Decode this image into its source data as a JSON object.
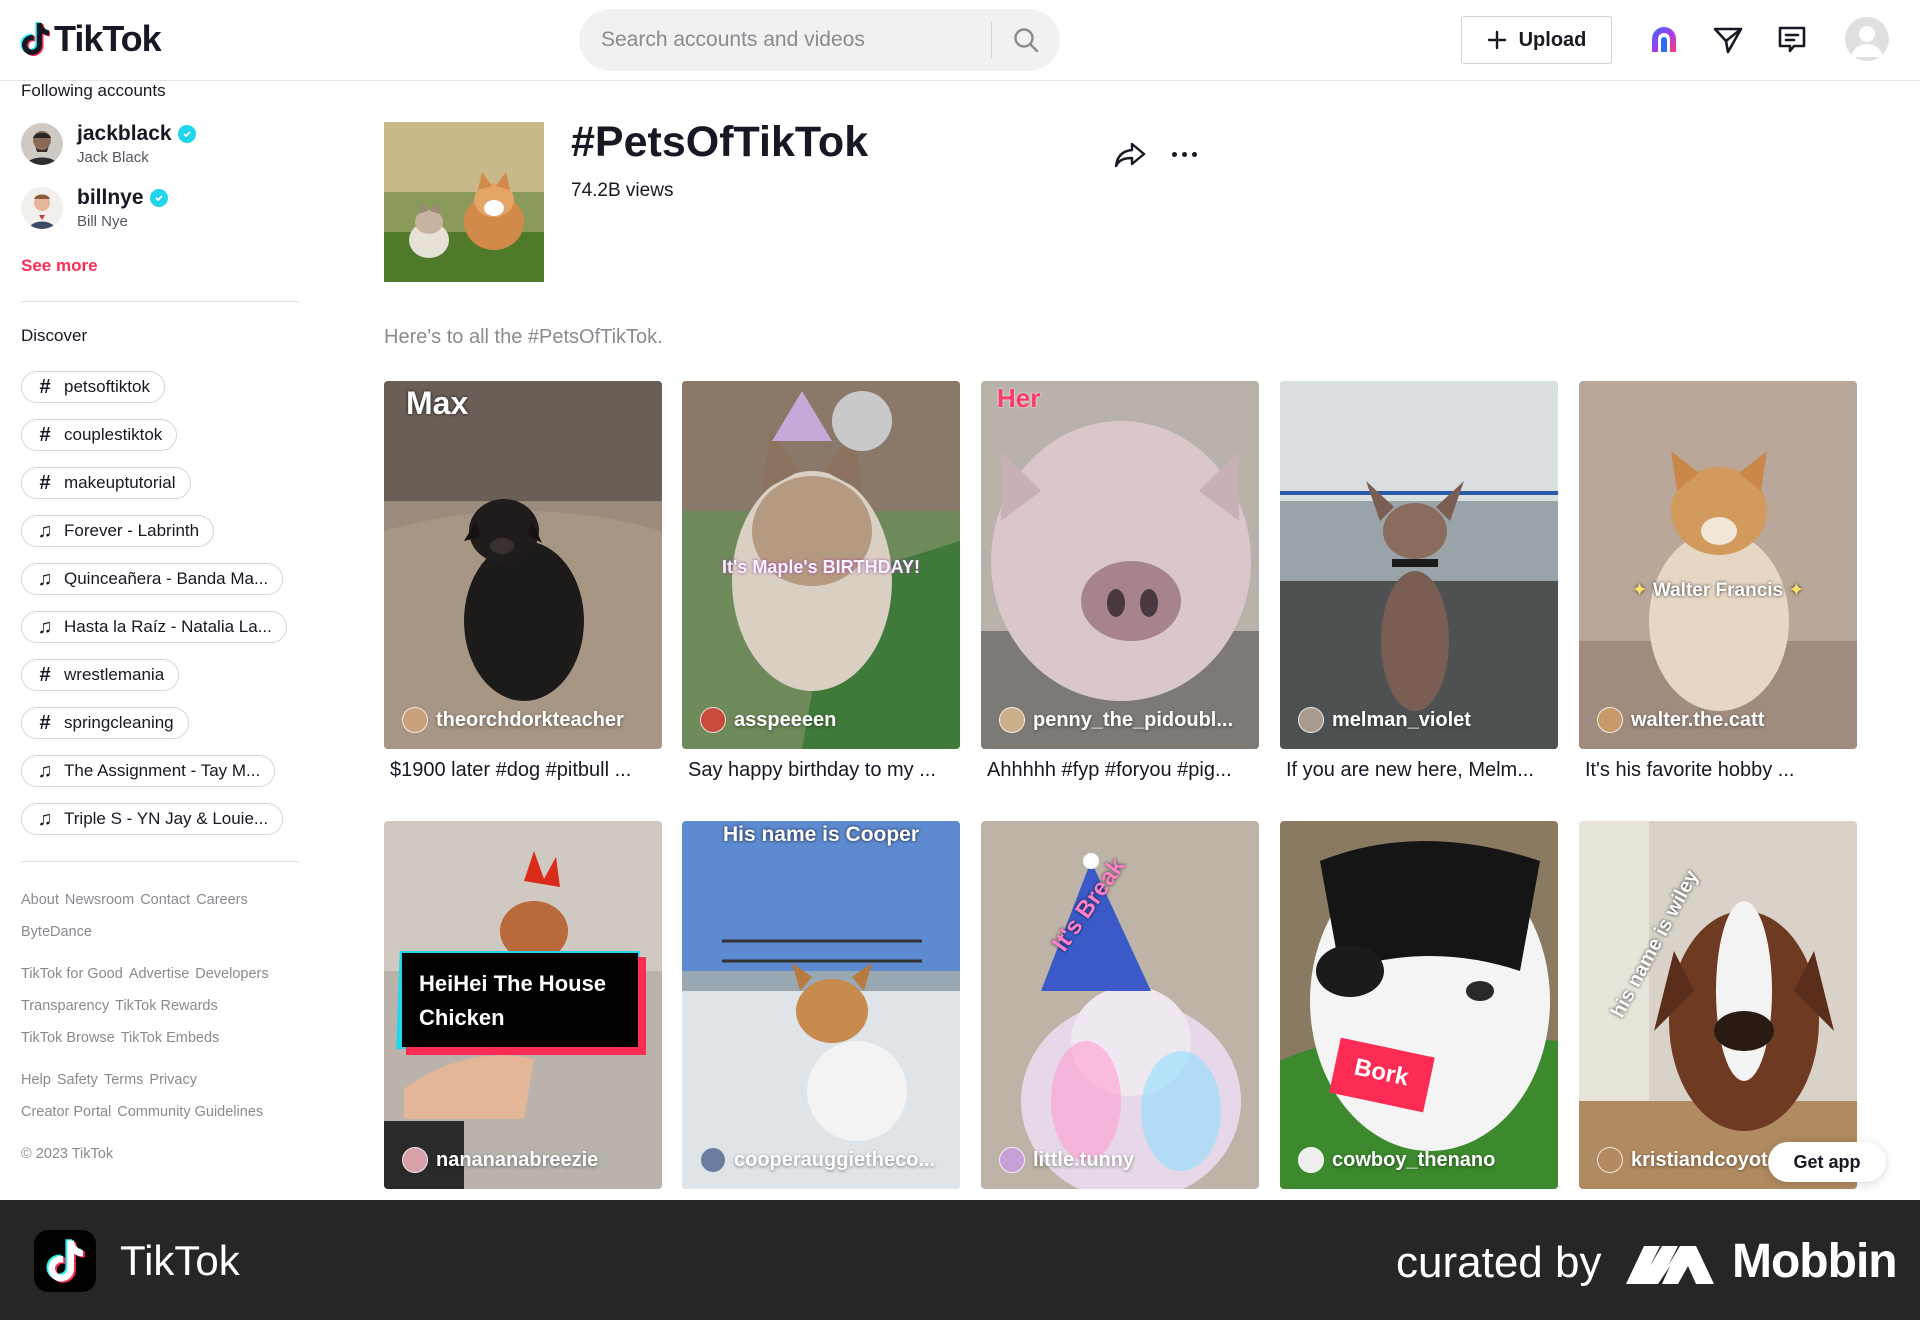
{
  "header": {
    "logo_text": "TikTok",
    "search_placeholder": "Search accounts and videos",
    "upload_label": "Upload"
  },
  "sidebar": {
    "following_title": "Following accounts",
    "accounts": [
      {
        "username": "jackblack",
        "display_name": "Jack Black"
      },
      {
        "username": "billnye",
        "display_name": "Bill Nye"
      }
    ],
    "see_more": "See more",
    "discover_title": "Discover",
    "discover_items": [
      {
        "type": "hashtag",
        "label": "petsoftiktok"
      },
      {
        "type": "hashtag",
        "label": "couplestiktok"
      },
      {
        "type": "hashtag",
        "label": "makeuptutorial"
      },
      {
        "type": "music",
        "label": "Forever - Labrinth"
      },
      {
        "type": "music",
        "label": "Quinceañera - Banda Ma..."
      },
      {
        "type": "music",
        "label": "Hasta la Raíz - Natalia La..."
      },
      {
        "type": "hashtag",
        "label": "wrestlemania"
      },
      {
        "type": "hashtag",
        "label": "springcleaning"
      },
      {
        "type": "music",
        "label": "The Assignment - Tay M..."
      },
      {
        "type": "music",
        "label": "Triple S - YN Jay & Louie..."
      }
    ],
    "footer_lines": [
      [
        "About",
        "Newsroom",
        "Contact",
        "Careers"
      ],
      [
        "ByteDance"
      ],
      [
        "TikTok for Good",
        "Advertise",
        "Developers"
      ],
      [
        "Transparency",
        "TikTok Rewards"
      ],
      [
        "TikTok Browse",
        "TikTok Embeds"
      ],
      [
        "Help",
        "Safety",
        "Terms",
        "Privacy"
      ],
      [
        "Creator Portal",
        "Community Guidelines"
      ]
    ],
    "copyright": "© 2023 TikTok"
  },
  "hashtag": {
    "title": "#PetsOfTikTok",
    "views": "74.2B views",
    "description": "Here's to all the #PetsOfTikTok."
  },
  "videos": [
    {
      "username": "theorchdorkteacher",
      "caption": "$1900 later #dog #pitbull ...",
      "overlay": "Max"
    },
    {
      "username": "asspeeeen",
      "caption": "Say happy birthday to my ...",
      "overlay": "It's Maple's BIRTHDAY!"
    },
    {
      "username": "penny_the_pidoubl...",
      "caption": "Ahhhhh #fyp #foryou #pig...",
      "overlay": "Her"
    },
    {
      "username": "melman_violet",
      "caption": "If you are new here, Melm...",
      "overlay": ""
    },
    {
      "username": "walter.the.catt",
      "caption": "It's his favorite hobby ...",
      "overlay": "Walter Francis"
    },
    {
      "username": "nanananabreezie",
      "caption": "",
      "overlay": "HeiHei The House Chicken"
    },
    {
      "username": "cooperauggietheco...",
      "caption": "",
      "overlay": "His name is Cooper"
    },
    {
      "username": "little.tunny",
      "caption": "",
      "overlay": "It's Break"
    },
    {
      "username": "cowboy_thenano",
      "caption": "",
      "overlay": "Bork"
    },
    {
      "username": "kristiandcoyote",
      "caption": "",
      "overlay": "his name is wiley"
    }
  ],
  "get_app": "Get app",
  "banner": {
    "app_name": "TikTok",
    "curated_by": "curated by",
    "brand": "Mobbin"
  },
  "colors": {
    "accent": "#fe2c55",
    "verified": "#20d5ec",
    "banner_bg": "#262626"
  }
}
